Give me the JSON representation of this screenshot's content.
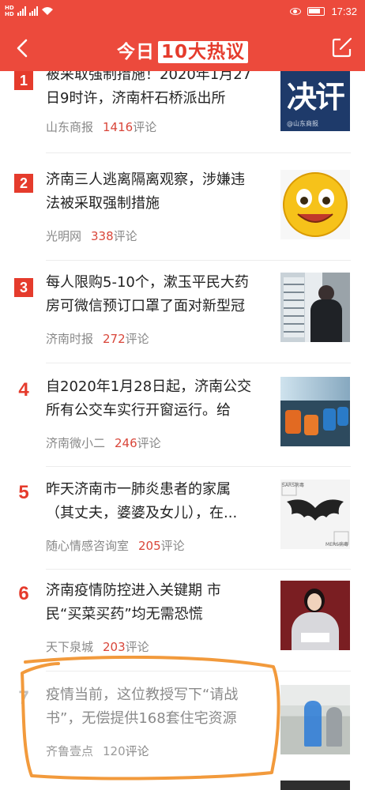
{
  "status": {
    "time": "17:32"
  },
  "header": {
    "title_prefix": "今日",
    "title_boxed": "10大热议"
  },
  "items": [
    {
      "rank": "1",
      "headline_l1": "被采取强制措施！2020年1月27",
      "headline_l2": "日9时许，济南杆石桥派出所",
      "source": "山东商报",
      "count": "1416",
      "unit": "评论",
      "thumb_text": "决讦",
      "thumb_caption": "@山东商报"
    },
    {
      "rank": "2",
      "headline_l1": "济南三人逃离隔离观察，涉嫌违",
      "headline_l2": "法被采取强制措施",
      "source": "光明网",
      "count": "338",
      "unit": "评论"
    },
    {
      "rank": "3",
      "headline_l1": "每人限购5-10个，漱玉平民大药",
      "headline_l2": "房可微信预订口罩了面对新型冠",
      "source": "济南时报",
      "count": "272",
      "unit": "评论"
    },
    {
      "rank": "4",
      "headline_l1": "自2020年1月28日起，济南公交",
      "headline_l2": "所有公交车实行开窗运行。给",
      "source": "济南微小二",
      "count": "246",
      "unit": "评论"
    },
    {
      "rank": "5",
      "headline_l1": "昨天济南市一肺炎患者的家属",
      "headline_l2": "（其丈夫，婆婆及女儿），在...",
      "source": "随心情感咨询室",
      "count": "205",
      "unit": "评论",
      "thumb_labels": [
        "SARS病毒",
        "MERS病毒"
      ]
    },
    {
      "rank": "6",
      "headline_l1": "济南疫情防控进入关键期 市",
      "headline_l2": "民“买菜买药”均无需恐慌",
      "source": "天下泉城",
      "count": "203",
      "unit": "评论"
    },
    {
      "rank": "7",
      "headline_l1": "疫情当前，这位教授写下“请战",
      "headline_l2": "书”，无偿提供168套住宅资源",
      "source": "齐鲁壹点",
      "count": "120",
      "unit": "评论"
    }
  ],
  "colors": {
    "header_bg": "#ec4a3c",
    "accent": "#e53b2c",
    "scribble": "#f29a3c"
  }
}
